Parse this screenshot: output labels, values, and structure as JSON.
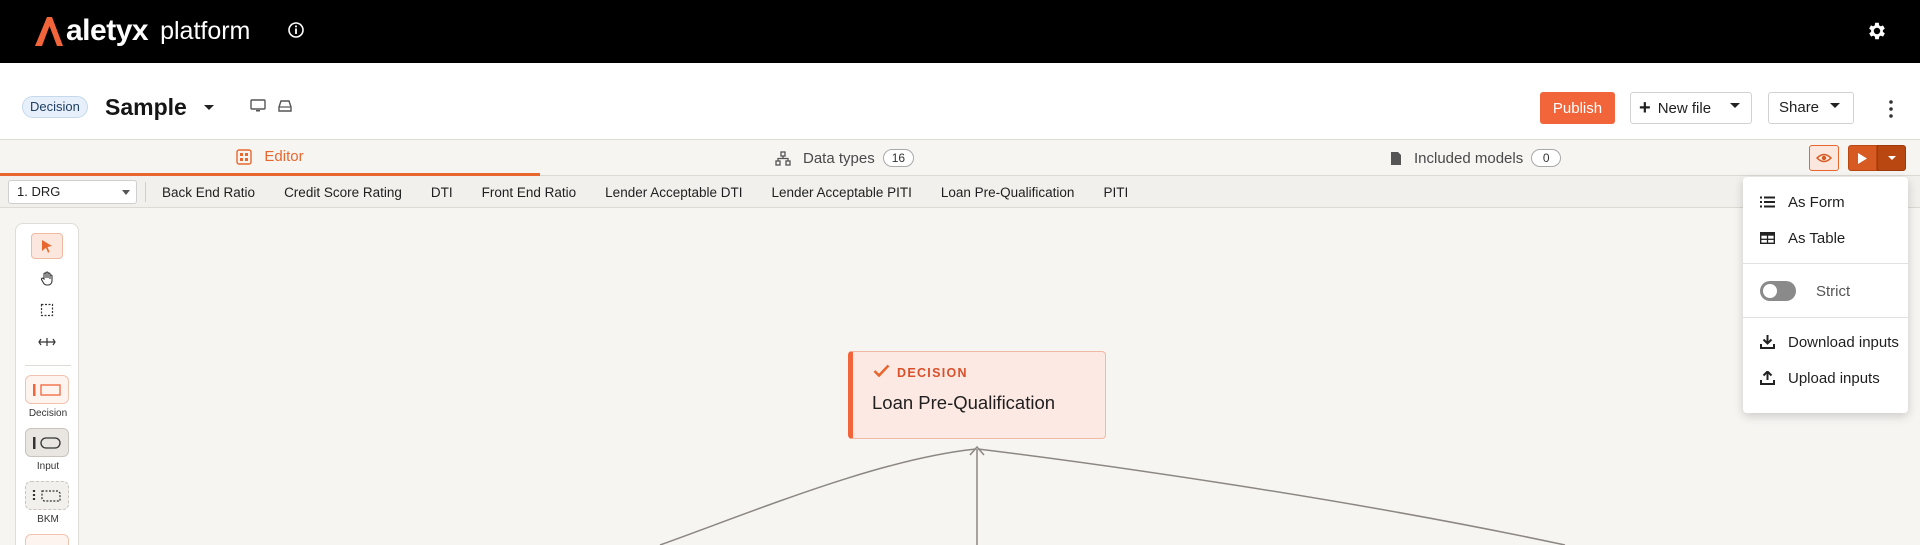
{
  "app": {
    "brand": "aletyx",
    "product": "platform"
  },
  "header": {
    "type_badge": "Decision",
    "model_name": "Sample",
    "publish_label": "Publish",
    "new_file_label": "New file",
    "share_label": "Share"
  },
  "tabs": {
    "editor": "Editor",
    "data_types": "Data types",
    "data_types_count": "16",
    "included_models": "Included models",
    "included_models_count": "0"
  },
  "node_bar": {
    "drg_select": "1. DRG",
    "links": [
      "Back End Ratio",
      "Credit Score Rating",
      "DTI",
      "Front End Ratio",
      "Lender Acceptable DTI",
      "Lender Acceptable PITI",
      "Loan Pre-Qualification",
      "PITI"
    ]
  },
  "palette": {
    "decision_label": "Decision",
    "input_label": "Input",
    "bkm_label": "BKM"
  },
  "canvas": {
    "node_type": "DECISION",
    "node_name": "Loan Pre-Qualification"
  },
  "run_menu": {
    "as_form": "As Form",
    "as_table": "As Table",
    "strict": "Strict",
    "download_inputs": "Download inputs",
    "upload_inputs": "Upload inputs"
  },
  "colors": {
    "accent": "#f2653a",
    "run": "#d65a21",
    "topbar": "#000000"
  },
  "icons": [
    "info-icon",
    "gear-icon",
    "chevron-down-icon",
    "monitor-icon",
    "drive-icon",
    "plus-icon",
    "kebab-icon",
    "editor-icon",
    "data-types-icon",
    "file-icon",
    "eye-icon",
    "play-icon",
    "pointer-icon",
    "hand-icon",
    "marquee-icon",
    "connector-icon",
    "check-icon",
    "list-icon",
    "table-icon",
    "download-icon",
    "upload-icon"
  ]
}
